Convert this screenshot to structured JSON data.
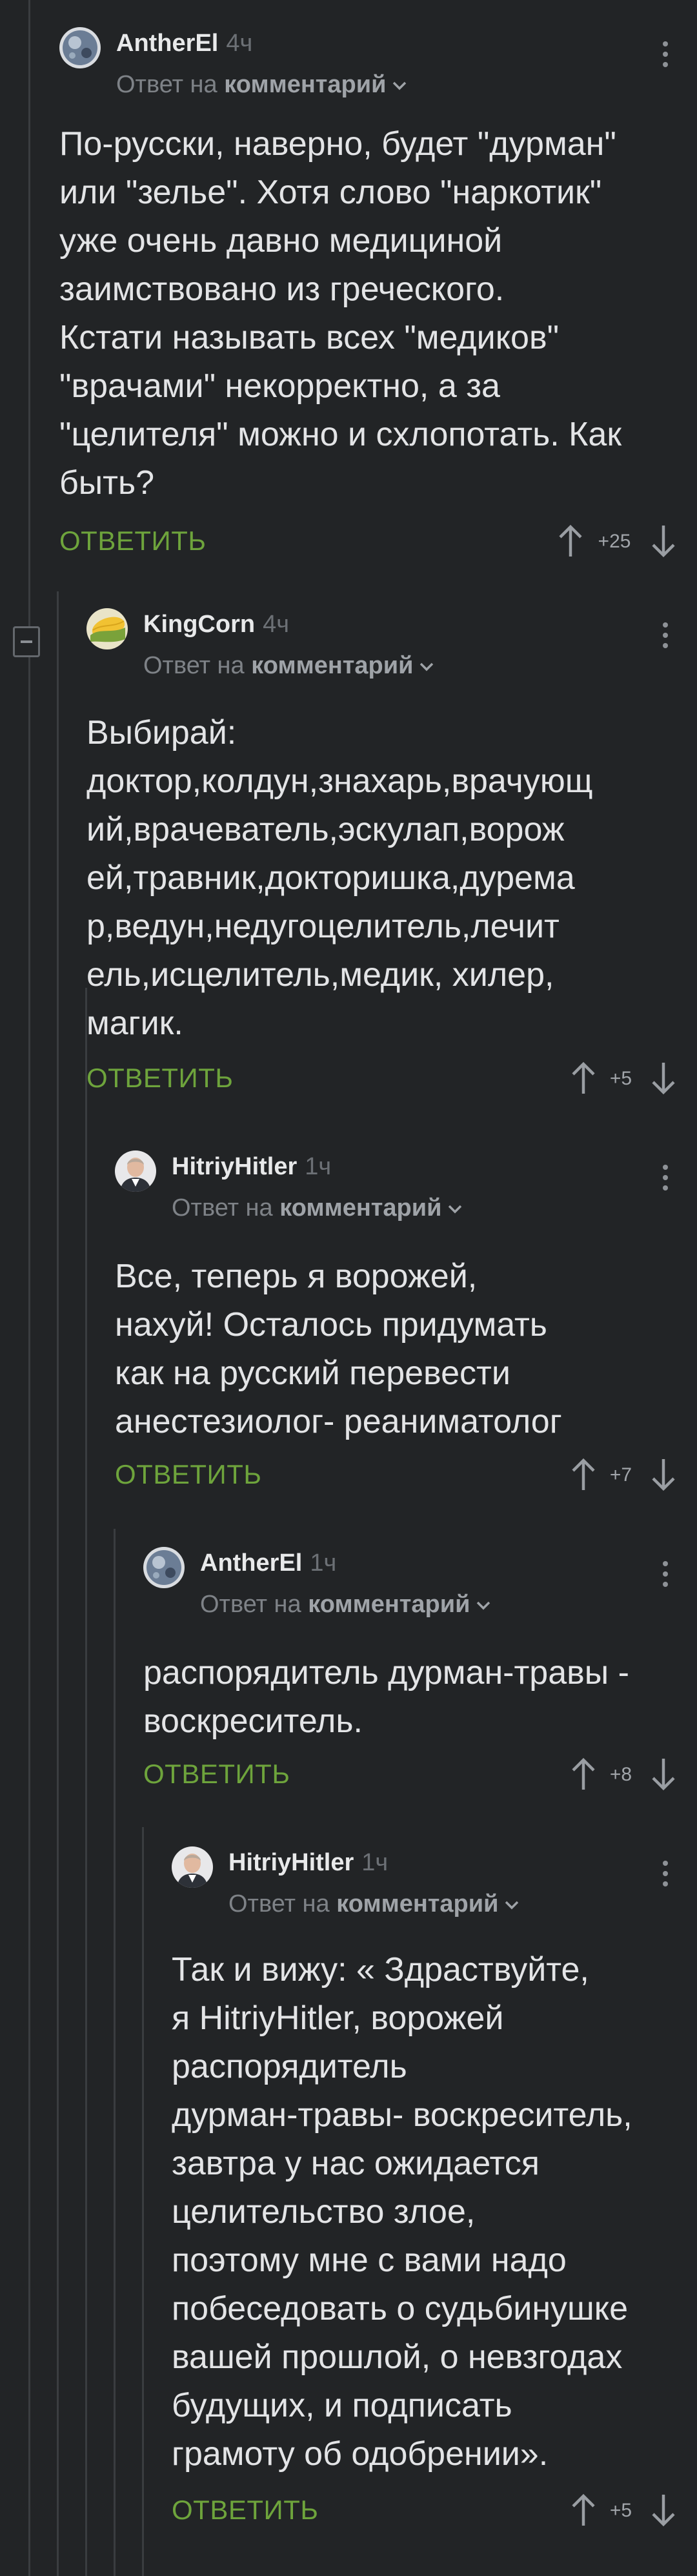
{
  "comments": [
    {
      "author": "AntherEl",
      "time": "4ч",
      "reply_prefix": "Ответ на",
      "reply_target": "комментарий",
      "text": "По-русски, наверно, будет \"дурман\"\nили \"зелье\". Хотя слово \"наркотик\"\nуже очень давно медициной\nзаимствовано из греческого.\nКстати называть всех \"медиков\"\n\"врачами\" некорректно, а за\n\"целителя\" можно и схлопотать. Как\nбыть?",
      "reply_label": "ОТВЕТИТЬ",
      "votes": "+25",
      "avatar_icon": "moon-globe-avatar"
    },
    {
      "author": "KingCorn",
      "time": "4ч",
      "reply_prefix": "Ответ на",
      "reply_target": "комментарий",
      "text": "Выбирай:\nдоктор,колдун,знахарь,врачующ\nий,врачеватель,эскулап,ворож\nей,травник,докторишка,дурема\nр,ведун,недугоцелитель,лечит\nель,исцелитель,медик, хилер,\nмагик.",
      "reply_label": "ОТВЕТИТЬ",
      "votes": "+5",
      "avatar_icon": "corn-avatar"
    },
    {
      "author": "HitriyHitler",
      "time": "1ч",
      "reply_prefix": "Ответ на",
      "reply_target": "комментарий",
      "text": "Все, теперь я ворожей,\nнахуй! Осталось придумать\nкак на русский перевести\nанестезиолог- реаниматолог",
      "reply_label": "ОТВЕТИТЬ",
      "votes": "+7",
      "avatar_icon": "portrait-avatar"
    },
    {
      "author": "AntherEl",
      "time": "1ч",
      "reply_prefix": "Ответ на",
      "reply_target": "комментарий",
      "text": "распорядитель дурман-травы -\nвоскреситель.",
      "reply_label": "ОТВЕТИТЬ",
      "votes": "+8",
      "avatar_icon": "moon-globe-avatar"
    },
    {
      "author": "HitriyHitler",
      "time": "1ч",
      "reply_prefix": "Ответ на",
      "reply_target": "комментарий",
      "text": "Так и вижу: « Здраствуйте,\nя HitriyHitler, ворожей\nраспорядитель\nдурман-травы- воскреситель,\nзавтра у нас ожидается\nцелительство злое,\nпоэтому мне с вами надо\nпобеседовать о судьбинушке\nвашей прошлой, о невзгодах\nбудущих, и подписать\nграмоту об одобрении».",
      "reply_label": "ОТВЕТИТЬ",
      "votes": "+5",
      "avatar_icon": "portrait-avatar"
    }
  ],
  "colors": {
    "background": "#222426",
    "reply_green": "#6ea43c",
    "muted": "#7e8287"
  }
}
